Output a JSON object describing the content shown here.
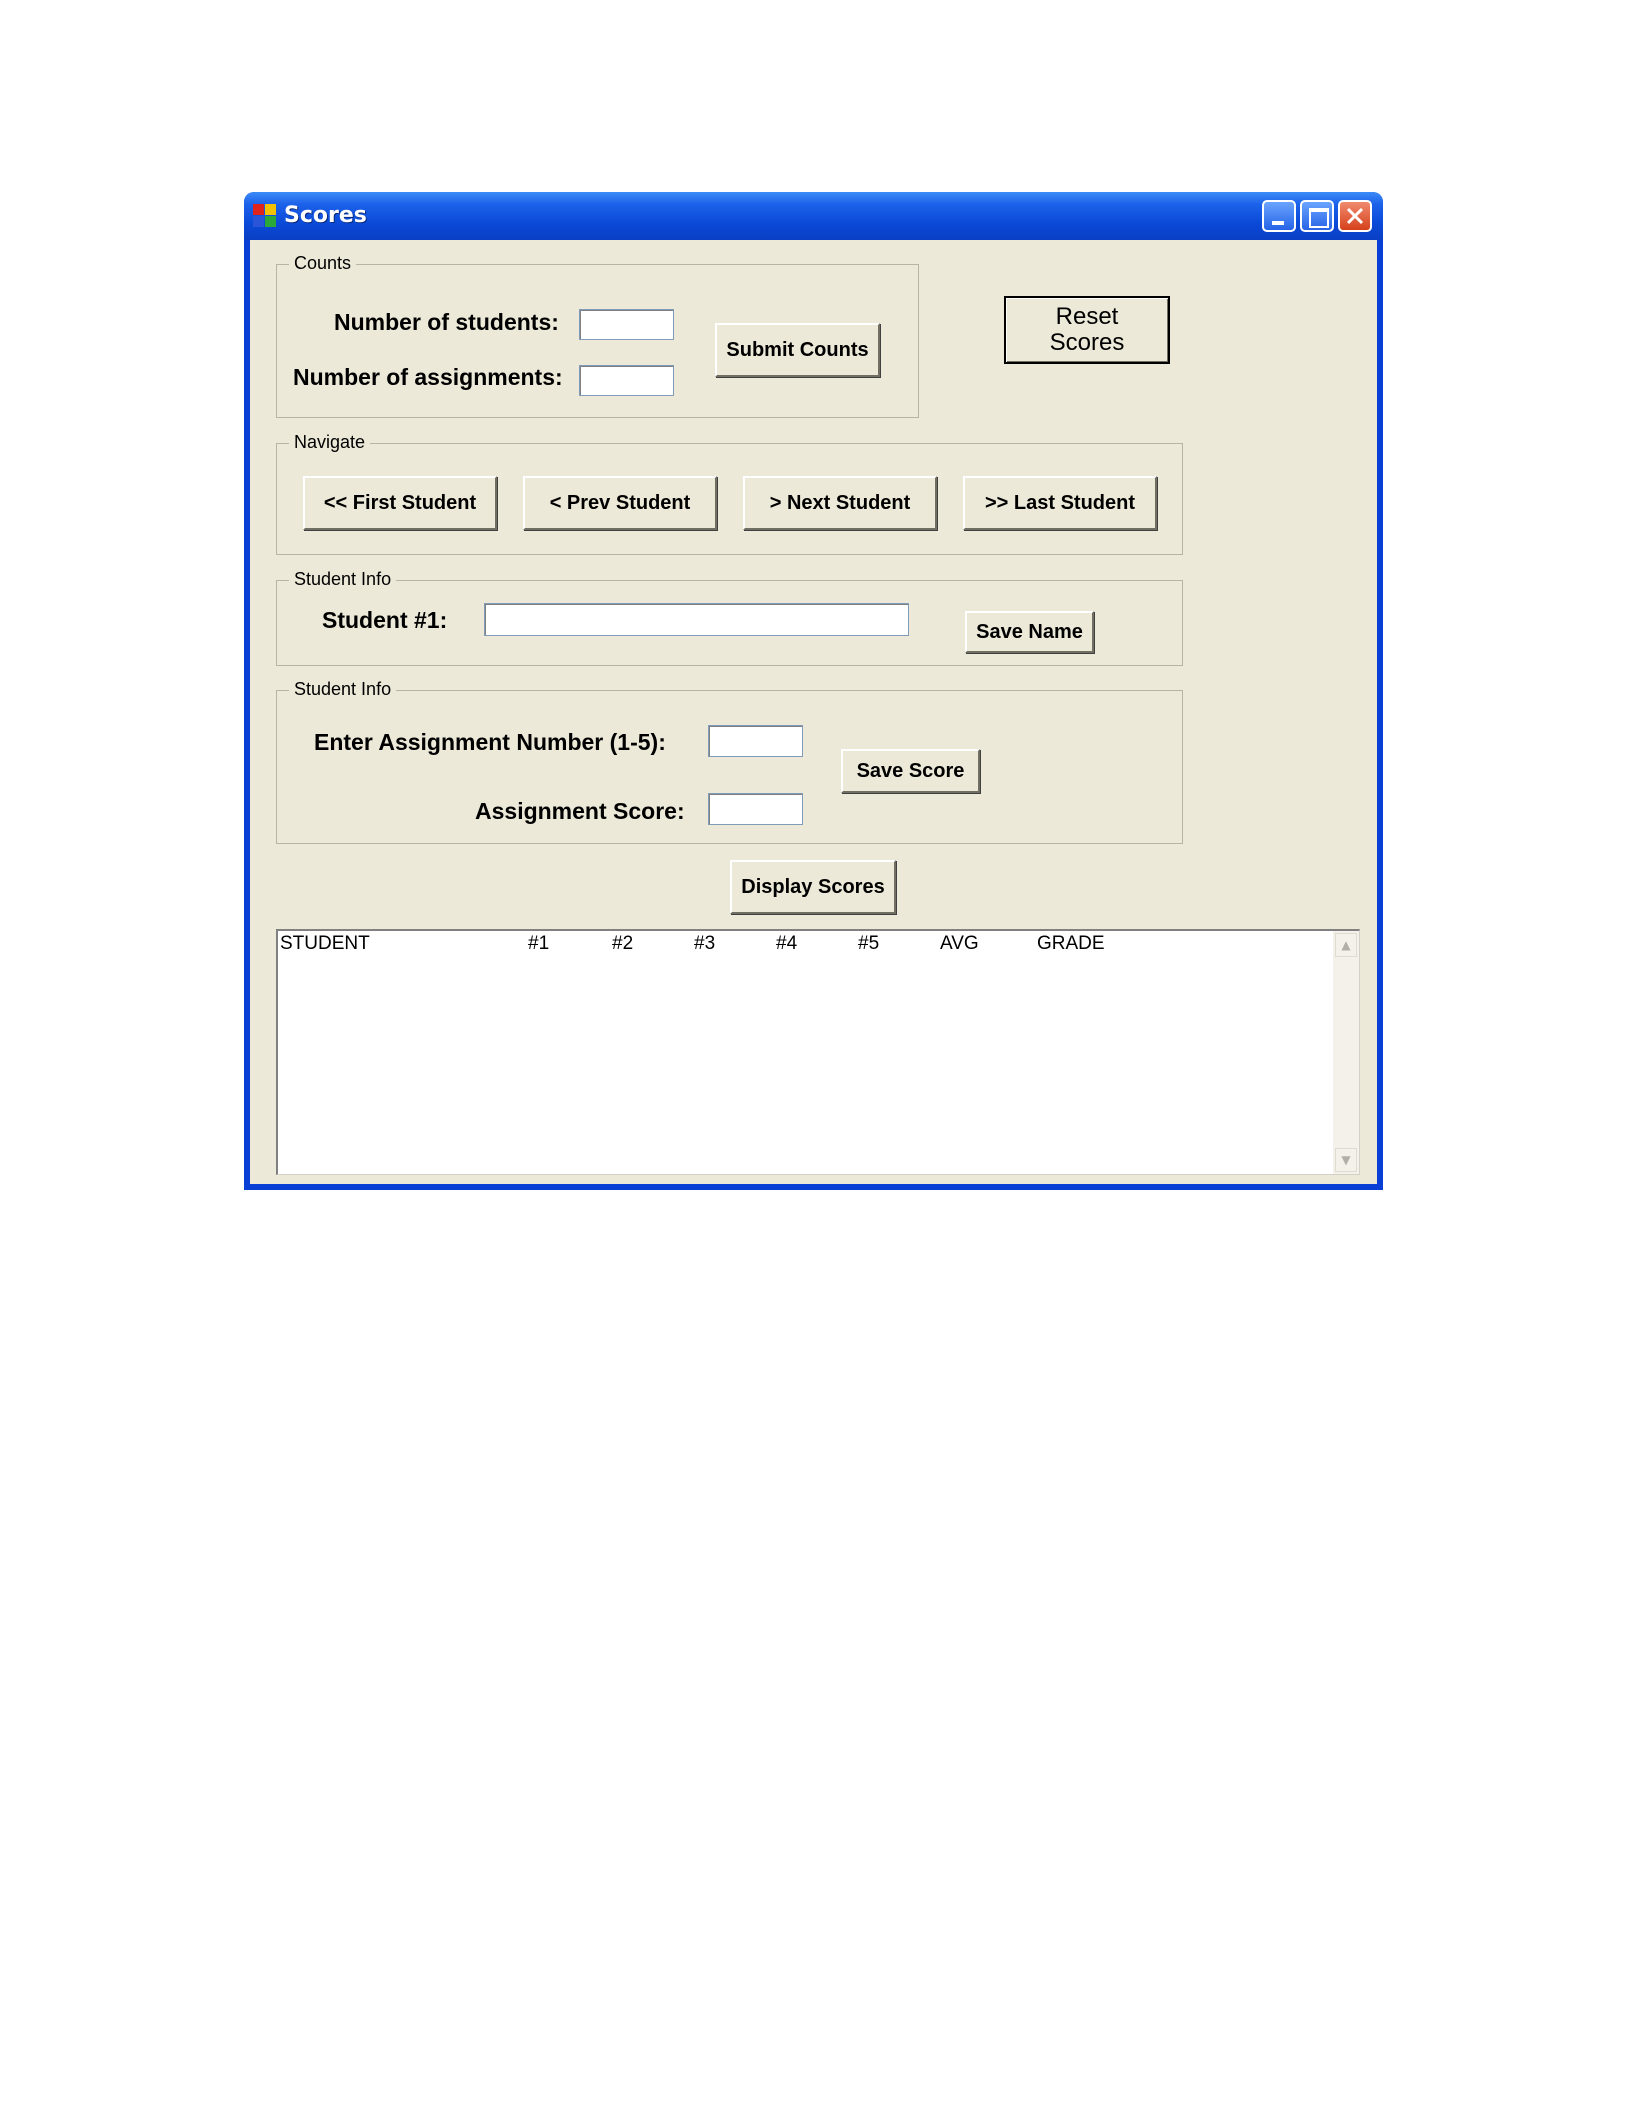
{
  "window": {
    "title": "Scores",
    "colors": {
      "titlebar": "#0a4ad8",
      "client": "#ece9d8"
    }
  },
  "counts": {
    "group_label": "Counts",
    "students_label": "Number of students:",
    "assignments_label": "Number of assignments:",
    "students_value": "",
    "assignments_value": "",
    "submit_label": "Submit Counts"
  },
  "reset": {
    "label": "Reset Scores"
  },
  "navigate": {
    "group_label": "Navigate",
    "first_label": "<< First Student",
    "prev_label": "< Prev Student",
    "next_label": "> Next Student",
    "last_label": ">> Last Student"
  },
  "student_info": {
    "group_label": "Student Info",
    "student_label": "Student #1:",
    "name_value": "",
    "save_name_label": "Save Name"
  },
  "score_info": {
    "group_label": "Student Info",
    "assignment_number_label": "Enter Assignment Number (1-5):",
    "assignment_score_label": "Assignment Score:",
    "assignment_number_value": "",
    "assignment_score_value": "",
    "save_score_label": "Save Score"
  },
  "display": {
    "label": "Display Scores"
  },
  "listbox": {
    "columns": [
      "STUDENT",
      "#1",
      "#2",
      "#3",
      "#4",
      "#5",
      "AVG",
      "GRADE"
    ],
    "scroll_up_icon": "▲",
    "scroll_down_icon": "▼"
  }
}
